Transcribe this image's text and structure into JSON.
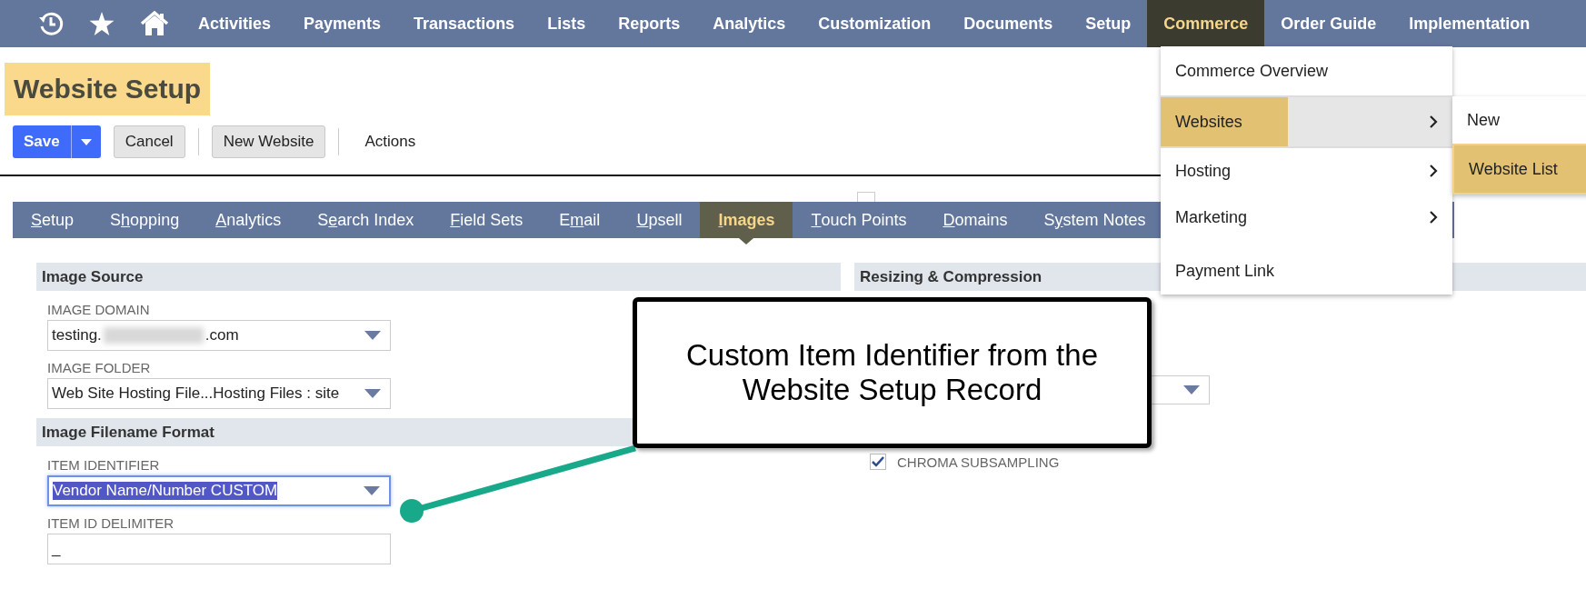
{
  "nav_items": [
    {
      "label": "Activities",
      "selected": false
    },
    {
      "label": "Payments",
      "selected": false
    },
    {
      "label": "Transactions",
      "selected": false
    },
    {
      "label": "Lists",
      "selected": false
    },
    {
      "label": "Reports",
      "selected": false
    },
    {
      "label": "Analytics",
      "selected": false
    },
    {
      "label": "Customization",
      "selected": false
    },
    {
      "label": "Documents",
      "selected": false
    },
    {
      "label": "Setup",
      "selected": false
    },
    {
      "label": "Commerce",
      "selected": true
    },
    {
      "label": "Order Guide",
      "selected": false
    },
    {
      "label": "Implementation",
      "selected": false
    }
  ],
  "page_title": "Website Setup",
  "toolbar": {
    "save": "Save",
    "buttons": [
      "Cancel",
      "New Website"
    ],
    "actions": "Actions"
  },
  "tabs": [
    {
      "key": "S",
      "post": "etup",
      "selected": false
    },
    {
      "pre": "S",
      "key": "h",
      "post": "opping",
      "selected": false
    },
    {
      "key": "A",
      "post": "nalytics",
      "selected": false
    },
    {
      "pre": "S",
      "key": "e",
      "post": "arch Index",
      "selected": false
    },
    {
      "key": "F",
      "post": "ield Sets",
      "selected": false
    },
    {
      "pre": "E",
      "key": "m",
      "post": "ail",
      "selected": false
    },
    {
      "key": "U",
      "post": "psell",
      "selected": false
    },
    {
      "key": "I",
      "post": "mages",
      "selected": true
    },
    {
      "key": "T",
      "post": "ouch Points",
      "selected": false
    },
    {
      "key": "D",
      "post": "omains",
      "selected": false
    },
    {
      "pre": "S",
      "key": "y",
      "post": "stem Notes",
      "selected": false
    }
  ],
  "left_sections": [
    {
      "title": "Image Source",
      "fields": [
        {
          "label": "IMAGE DOMAIN",
          "kind": "select",
          "value_start": "testing.",
          "blurred": true,
          "value_end": ".com",
          "focused": false
        },
        {
          "label": "IMAGE FOLDER",
          "kind": "select",
          "value_start": "Web Site Hosting File...Hosting Files : site",
          "focused": false
        }
      ]
    },
    {
      "title": "Image Filename Format",
      "fields": [
        {
          "label": "ITEM IDENTIFIER",
          "kind": "select",
          "value_start": "Vendor Name/Number CUSTOM",
          "focused": true
        },
        {
          "label": "ITEM ID DELIMITER",
          "kind": "text",
          "value_start": "_",
          "focused": false
        }
      ]
    }
  ],
  "right_section": {
    "title": "Resizing & Compression",
    "fields": [
      {
        "kind": "select"
      },
      {
        "kind": "checkbox",
        "label": "CHROMA SUBSAMPLING",
        "checked": true
      }
    ]
  },
  "callout": {
    "text": "Custom Item Identifier from the Website Setup Record"
  },
  "menu": {
    "items": [
      {
        "label": "Commerce Overview",
        "selected": false,
        "submenu": false
      },
      {
        "label": "Websites",
        "selected": true,
        "submenu": true
      },
      {
        "label": "Hosting",
        "selected": false,
        "submenu": true
      },
      {
        "label": "Marketing",
        "selected": false,
        "submenu": true
      },
      {
        "label": "Payment Link",
        "selected": false,
        "submenu": false
      }
    ]
  },
  "submenu": {
    "items": [
      {
        "label": "New",
        "selected": false
      },
      {
        "label": "Website List",
        "selected": true
      }
    ]
  }
}
